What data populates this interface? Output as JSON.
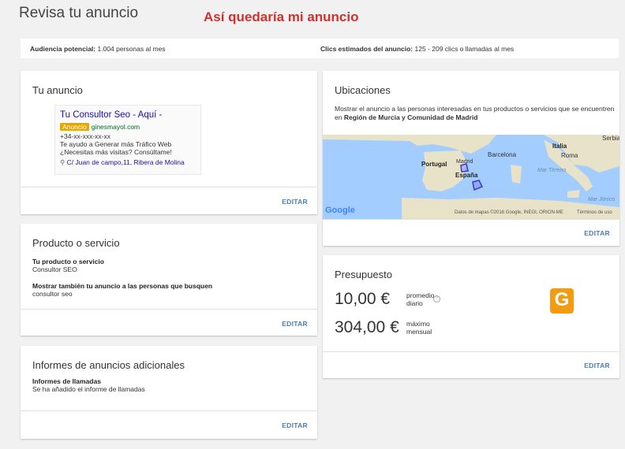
{
  "header": {
    "title": "Revisa tu anuncio",
    "annotation": "Así quedaría mi anuncio"
  },
  "stats": {
    "audience_label": "Audiencia potencial:",
    "audience_value": "1.004 personas al mes",
    "clicks_label": "Clics estimados del anuncio:",
    "clicks_value": "125 - 209 clics o llamadas al mes"
  },
  "ad_card": {
    "title": "Tu anuncio",
    "headline": "Tu Consultor Seo - Aquí -",
    "badge": "Anuncio",
    "display_url": "ginesmayol.com",
    "phone": "+34-xx-xxx-xx-xx",
    "description_1": "Te ayudo a Generar más Tráfico Web",
    "description_2": "¿Necesitas más visitas? Consúltame!",
    "address": "C/ Juan de campo,11, Ribera de Molina",
    "edit_label": "EDITAR"
  },
  "product_card": {
    "title": "Producto o servicio",
    "product_label": "Tu producto o servicio",
    "product_value": "Consultor SEO",
    "also_show_label": "Mostrar también tu anuncio a las personas que busquen",
    "also_show_value": "consultor seo",
    "edit_label": "EDITAR"
  },
  "reports_card": {
    "title": "Informes de anuncios adicionales",
    "reports_label": "Informes de llamadas",
    "reports_value": "Se ha añadido el informe de llamadas",
    "edit_label": "EDITAR"
  },
  "locations_card": {
    "title": "Ubicaciones",
    "description": "Mostrar el anuncio a las personas interesadas en tus productos o servicios que se encuentren en",
    "regions": "Región de Murcia y Comunidad de Madrid",
    "map": {
      "labels": [
        "Italia",
        "Serbia",
        "Portugal",
        "Madrid",
        "Barcelona",
        "Roma",
        "España",
        "Mar Tirreno",
        "Mar Jónico"
      ],
      "logo": "Google",
      "attribution": "Datos de mapas ©2016 Google, INEGI, ORION-ME",
      "terms": "Términos de uso",
      "land_color": "#e8e3c8",
      "sea_color": "#a3ccff",
      "region_color": "#3a3acc"
    },
    "edit_label": "EDITAR"
  },
  "budget_card": {
    "title": "Presupuesto",
    "daily_amount": "10,00 €",
    "daily_unit_1": "promedio",
    "daily_unit_2": "diario",
    "help_icon": "?",
    "monthly_amount": "304,00 €",
    "monthly_unit_1": "máximo",
    "monthly_unit_2": "mensual",
    "logo_letter": "G",
    "edit_label": "EDITAR"
  }
}
